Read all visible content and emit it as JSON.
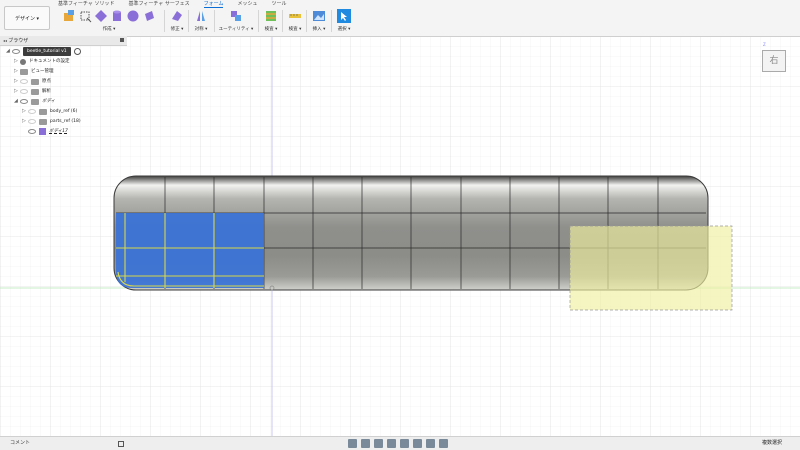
{
  "toolbar": {
    "design_label": "デザイン ▾",
    "tabs": [
      "基準フィーチャ ソリッド",
      "基準フィーチャ サーフェス",
      "フォーム",
      "メッシュ",
      "ツール"
    ],
    "active_tab": "フォーム",
    "groups": {
      "create": "作成 ▾",
      "modify": "修正 ▾",
      "symmetry": "対称 ▾",
      "utilities": "ユーティリティ ▾",
      "inspect": "検査 ▾",
      "insert": "挿入 ▾",
      "select": "選択 ▾",
      "check": "検査 ▾"
    }
  },
  "browser": {
    "title": "ブラウザ",
    "items": [
      {
        "label": "beetle_tutorial v1",
        "level": 0
      },
      {
        "label": "ドキュメントの設定",
        "level": 1
      },
      {
        "label": "ビュー管理",
        "level": 1
      },
      {
        "label": "原点",
        "level": 1
      },
      {
        "label": "解析",
        "level": 1
      },
      {
        "label": "ボディ",
        "level": 1
      },
      {
        "label": "body_ref (6)",
        "level": 2
      },
      {
        "label": "parts_ref (18)",
        "level": 2
      },
      {
        "label": "ボディ17",
        "level": 2
      }
    ]
  },
  "viewcube": {
    "face_label": "右",
    "axis": "Z"
  },
  "status": {
    "comment_label": "コメント",
    "selection_label": "複数選択"
  },
  "colors": {
    "accent": "#0a6cd5",
    "selection_blue": "#3a72d8",
    "window_yellow": "#f0f0a0",
    "body_gray": "#8f8f8c"
  }
}
